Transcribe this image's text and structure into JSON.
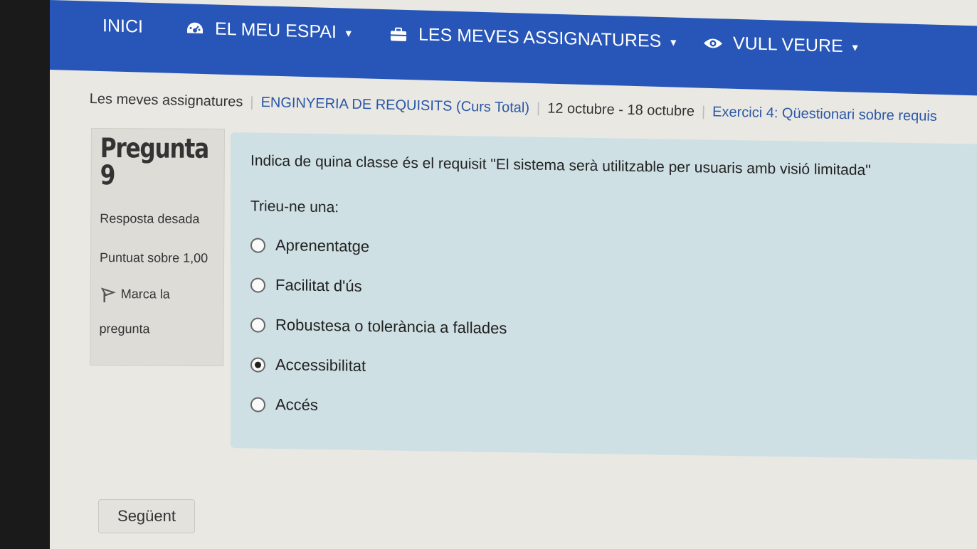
{
  "nav": {
    "home": "INICI",
    "my_space": "EL MEU ESPAI",
    "my_courses": "LES MEVES ASSIGNATURES",
    "want_to_see": "VULL VEURE"
  },
  "breadcrumb": {
    "items": [
      "Les meves assignatures",
      "ENGINYERIA DE REQUISITS (Curs Total)",
      "12 octubre - 18 octubre",
      "Exercici 4: Qüestionari sobre requis"
    ]
  },
  "question": {
    "title_word": "Pregunta",
    "number": "9",
    "status": "Resposta desada",
    "score": "Puntuat sobre 1,00",
    "flag_line1": "Marca la",
    "flag_line2": "pregunta",
    "text": "Indica de quina classe és el requisit \"El sistema serà utilitzable per usuaris amb visió limitada\"",
    "prompt": "Trieu-ne una:",
    "options": [
      {
        "label": "Aprenentatge",
        "selected": false
      },
      {
        "label": "Facilitat d'ús",
        "selected": false
      },
      {
        "label": "Robustesa o tolerància a fallades",
        "selected": false
      },
      {
        "label": "Accessibilitat",
        "selected": true
      },
      {
        "label": "Accés",
        "selected": false
      }
    ]
  },
  "buttons": {
    "next": "Següent"
  },
  "colors": {
    "navbar": "#2756b8",
    "content_bg": "#cee0e4",
    "link": "#2b57a6"
  }
}
